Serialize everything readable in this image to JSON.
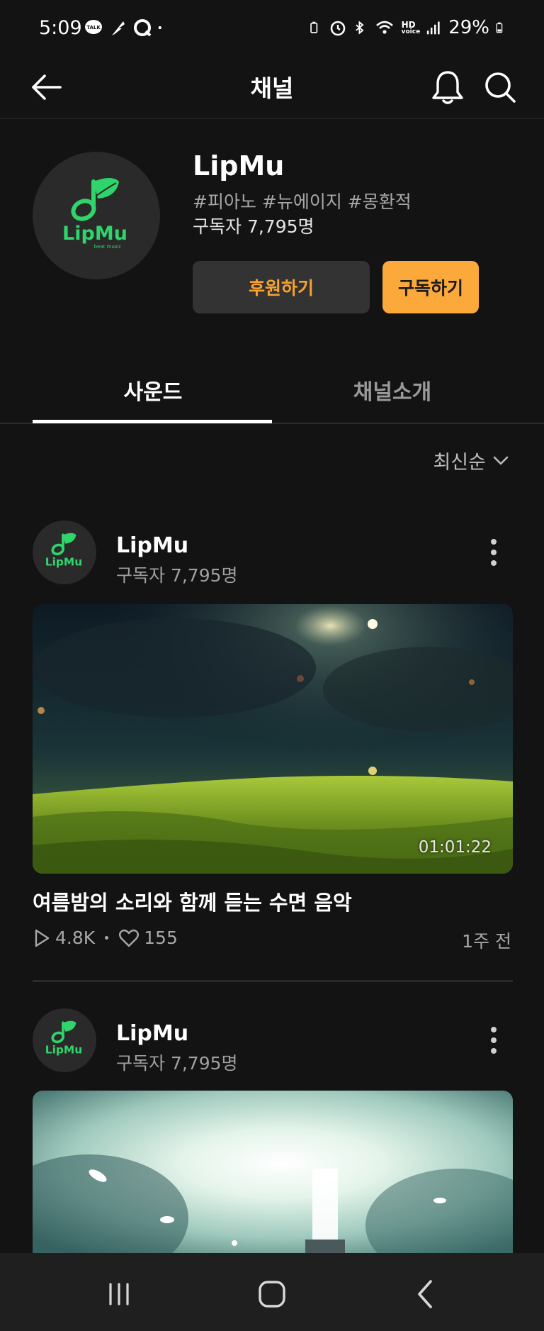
{
  "status_bar": {
    "time": "5:09",
    "battery": "29%",
    "hd_label": "HD",
    "voice_label": "voice",
    "talk_label": "TALK"
  },
  "header": {
    "title": "채널"
  },
  "channel": {
    "name": "LipMu",
    "tags": "#피아노 #뉴에이지 #몽환적",
    "subscribers": "구독자 7,795명",
    "logo_text": "LipMu",
    "logo_subtext": "beat music",
    "support_label": "후원하기",
    "subscribe_label": "구독하기"
  },
  "tabs": [
    {
      "label": "사운드",
      "active": true
    },
    {
      "label": "채널소개",
      "active": false
    }
  ],
  "sort": {
    "label": "최신순"
  },
  "posts": [
    {
      "author": "LipMu",
      "subscribers": "구독자 7,795명",
      "duration": "01:01:22",
      "title": "여름밤의 소리와 함께 듣는 수면 음악",
      "plays": "4.8K",
      "likes": "155",
      "age": "1주 전"
    },
    {
      "author": "LipMu",
      "subscribers": "구독자 7,795명"
    }
  ],
  "colors": {
    "background": "#131313",
    "accent": "#fba93a",
    "support_text": "#f7a231",
    "logo_green": "#2fd56a"
  }
}
